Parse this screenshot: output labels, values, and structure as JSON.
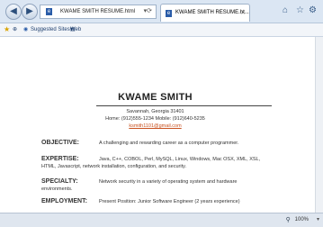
{
  "browser": {
    "address": "KWAME SMITH RESUME.html",
    "tab_title": "KWAME SMITH RESUME.ht...",
    "favorites": {
      "suggested_sites": "Suggested Sites",
      "web_slice_gallery": "Web Slice Gallery"
    },
    "status": {
      "zoom": "100%"
    }
  },
  "resume": {
    "name": "KWAME SMITH",
    "address": "Savannah, Georgia 31401",
    "phones": "Home: (912)555-1234 Mobile: (912)640-5235",
    "email": "ksmith1101@gmail.com",
    "sections": {
      "objective": {
        "label": "OBJECTIVE:",
        "text": "A challenging and rewarding career as a computer programmer."
      },
      "expertise": {
        "label": "EXPERTISE:",
        "text1": "Java, C++, COBOL, Perl, MySQL, Linux, Windows, Mac OSX, XML, XSL,",
        "text2": "HTML, Javascript, network installation, configuration, and security."
      },
      "specialty": {
        "label": "SPECIALTY:",
        "text1": "Network security in a variety of operating system and hardware",
        "text2": "environments."
      },
      "employment": {
        "label": "EMPLOYMENT:",
        "text": "Present Position: Junior Software Engineer (2 years experience)"
      }
    }
  }
}
